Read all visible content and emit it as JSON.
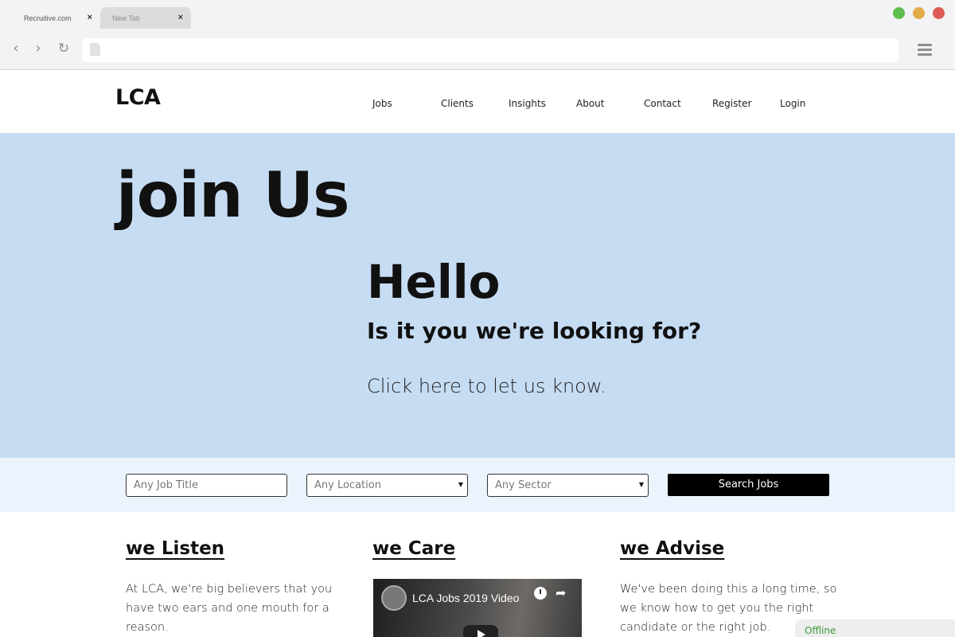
{
  "browser": {
    "tabs": [
      {
        "title": "Recruitive.com",
        "close": "×"
      },
      {
        "title": "New Tab",
        "close": "×"
      }
    ],
    "nav": {
      "back": "‹",
      "forward": "›",
      "reload": "↻"
    },
    "colors": {
      "traffic_green": "#5fbe4e",
      "traffic_yellow": "#e2ac48",
      "traffic_red": "#df5a57"
    }
  },
  "site": {
    "logo": "LCA",
    "nav": [
      "Jobs",
      "Clients",
      "Insights",
      "About",
      "Contact",
      "Register",
      "Login"
    ]
  },
  "hero": {
    "title": "join Us",
    "hello": "Hello",
    "subtitle": "Is it you we're looking for?",
    "cta": "Click here to let us know.",
    "background": "#c6dcf3"
  },
  "search": {
    "job_title_placeholder": "Any Job Title",
    "location": "Any Location",
    "sector": "Any Sector",
    "button": "Search Jobs"
  },
  "columns": [
    {
      "heading": "we Listen",
      "text": "At LCA, we're big believers that you have two ears and one mouth for a reason."
    },
    {
      "heading": "we Care",
      "video_title": "LCA Jobs 2019 Video"
    },
    {
      "heading": "we Advise",
      "text": "We've been doing this a long time, so we know how to get you the right candidate or the right job."
    }
  ],
  "chat": {
    "status": "Offline"
  }
}
